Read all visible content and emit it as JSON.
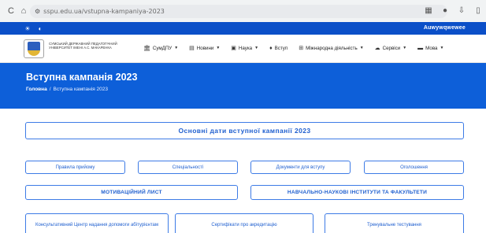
{
  "browser": {
    "back_icon": "back-icon",
    "home_icon": "home-icon",
    "url": "sspu.edu.ua/vstupna-kampaniya-2023"
  },
  "top_strip": {
    "icons": [
      "sun-icon",
      "contrast-icon"
    ],
    "text": "Auwywqwewee"
  },
  "header": {
    "university_name": "Сумський державний педагогічний університет імені А.С. Макаренка",
    "menu": [
      {
        "label": "СумДПУ",
        "icon": "bank-icon",
        "caret": true
      },
      {
        "label": "Новини",
        "icon": "news-icon",
        "caret": true
      },
      {
        "label": "Наука",
        "icon": "book-icon",
        "caret": true
      },
      {
        "label": "Вступ",
        "icon": "person-icon",
        "caret": false
      },
      {
        "label": "Міжнародна діяльність",
        "icon": "globe-icon",
        "caret": true
      },
      {
        "label": "Сервіси",
        "icon": "cloud-icon",
        "caret": true
      },
      {
        "label": "Мова",
        "icon": "flag-icon",
        "caret": true
      }
    ]
  },
  "hero": {
    "title": "Вступна кампанія 2023",
    "breadcrumb_home": "Головна",
    "breadcrumb_separator": "/",
    "breadcrumb_current": "Вступна кампанія 2023"
  },
  "content": {
    "main_button": "Основні дати вступної кампанії 2023",
    "row1": [
      "Правила прийому",
      "Спеціальності",
      "Документи для вступу",
      "Оголошення"
    ],
    "row2": [
      "МОТИВАЦІЙНИЙ ЛИСТ",
      "НАВЧАЛЬНО-НАУКОВІ ІНСТИТУТИ ТА ФАКУЛЬТЕТИ"
    ],
    "row3": [
      "Консультативний Центр надання допомоги абітурієнтам",
      "Сертифікати про акредитацію",
      "Тренувальне тестування"
    ]
  }
}
